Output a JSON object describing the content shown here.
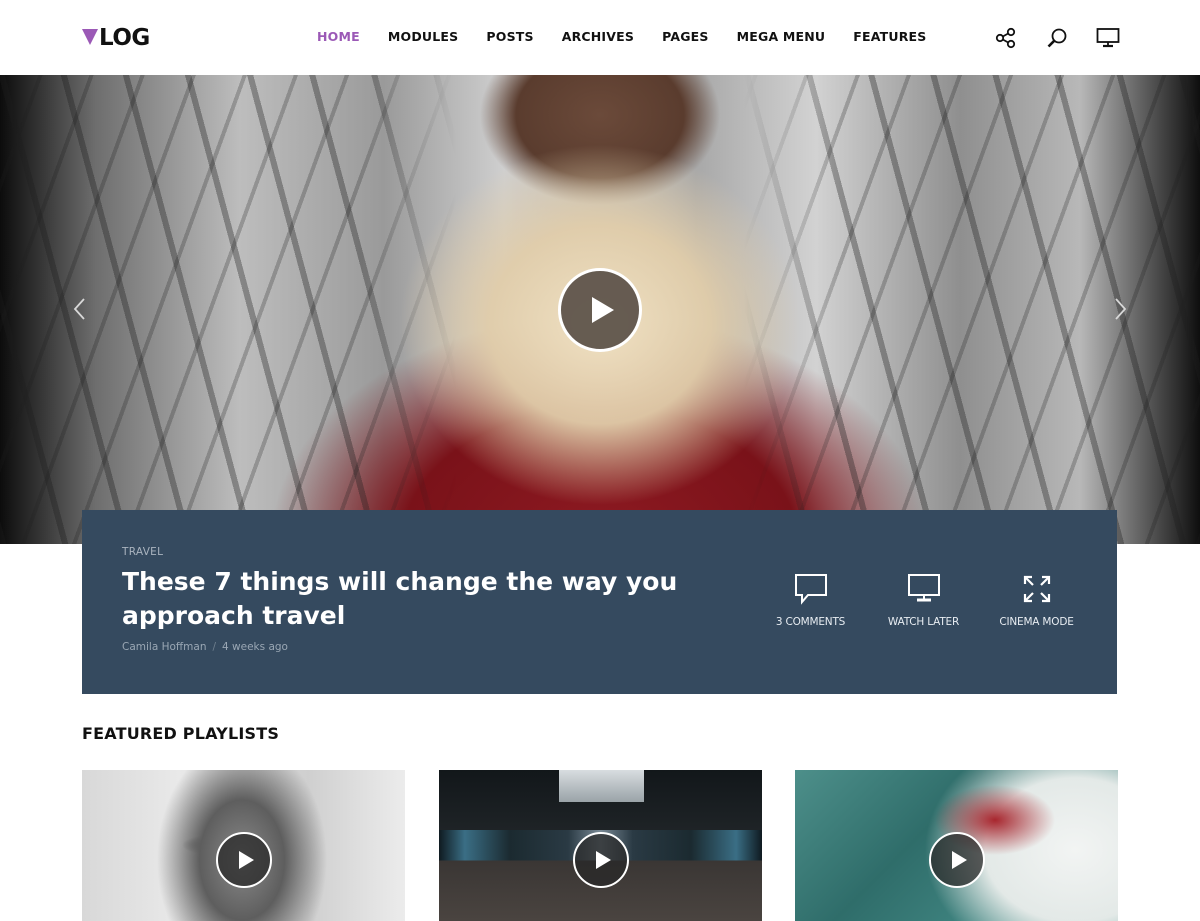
{
  "header": {
    "logo_text": "LOG",
    "brand_color": "#9b59b6",
    "nav": [
      {
        "label": "HOME",
        "active": true
      },
      {
        "label": "MODULES",
        "active": false
      },
      {
        "label": "POSTS",
        "active": false
      },
      {
        "label": "ARCHIVES",
        "active": false
      },
      {
        "label": "PAGES",
        "active": false
      },
      {
        "label": "MEGA MENU",
        "active": false
      },
      {
        "label": "FEATURES",
        "active": false
      }
    ],
    "icons": [
      "share-icon",
      "search-icon",
      "monitor-icon"
    ]
  },
  "hero": {
    "image_desc": "Back of man's head wearing a crown and white fur collar over red velvet cloak, blurred branches background",
    "play_icon": "play-icon",
    "prev_icon": "chevron-left-icon",
    "next_icon": "chevron-right-icon"
  },
  "post": {
    "category": "TRAVEL",
    "title": "These 7 things will change the way you approach travel",
    "author": "Camila Hoffman",
    "separator": "/",
    "date": "4 weeks ago",
    "background_color": "#354a5f",
    "actions": [
      {
        "label": "3 COMMENTS",
        "icon": "comment-icon"
      },
      {
        "label": "WATCH LATER",
        "icon": "monitor-icon"
      },
      {
        "label": "CINEMA MODE",
        "icon": "expand-icon"
      }
    ]
  },
  "featured": {
    "title": "FEATURED PLAYLISTS",
    "playlists": [
      {
        "image_desc": "Black and white portrait of elderly man",
        "icon": "play-icon"
      },
      {
        "image_desc": "Symmetric airport escalators with windows",
        "icon": "play-icon"
      },
      {
        "image_desc": "Surfer in red shirt riding a wave",
        "icon": "play-icon"
      }
    ]
  }
}
